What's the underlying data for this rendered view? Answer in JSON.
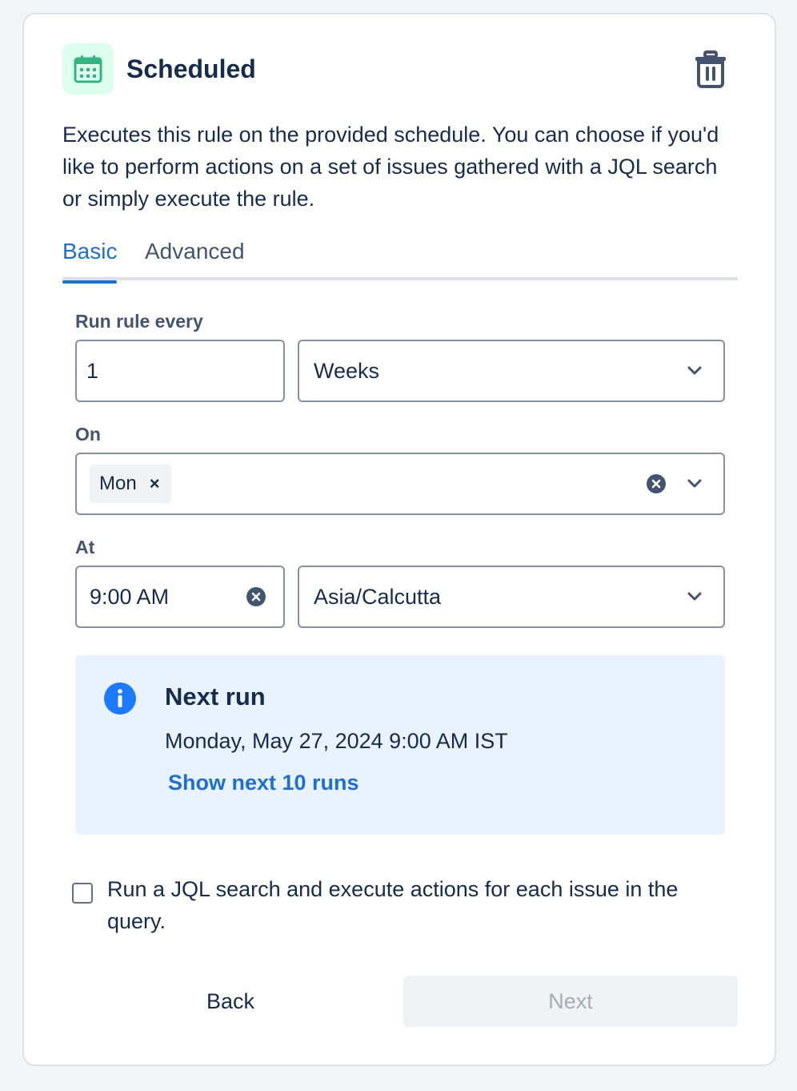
{
  "header": {
    "title": "Scheduled",
    "icon": "calendar-icon",
    "icon_color": "#36b37e",
    "delete_icon": "trash-icon"
  },
  "description": "Executes this rule on the provided schedule. You can choose if you'd like to perform actions on a set of issues gathered with a JQL search or simply execute the rule.",
  "tabs": [
    {
      "label": "Basic",
      "active": true
    },
    {
      "label": "Advanced",
      "active": false
    }
  ],
  "form": {
    "run_every": {
      "label": "Run rule every",
      "value": "1",
      "unit": "Weeks"
    },
    "on": {
      "label": "On",
      "selected_days": [
        "Mon"
      ],
      "chip_remove": "×"
    },
    "at": {
      "label": "At",
      "time": "9:00 AM",
      "timezone": "Asia/Calcutta"
    }
  },
  "next_run": {
    "title": "Next run",
    "date": "Monday, May 27, 2024 9:00 AM IST",
    "link": "Show next 10 runs"
  },
  "jql_checkbox": {
    "label": "Run a JQL search and execute actions for each issue in the query.",
    "checked": false
  },
  "footer": {
    "back_label": "Back",
    "next_label": "Next",
    "next_disabled": true
  },
  "colors": {
    "accent": "#1f6fd1",
    "info_background": "#e9f2ff"
  }
}
